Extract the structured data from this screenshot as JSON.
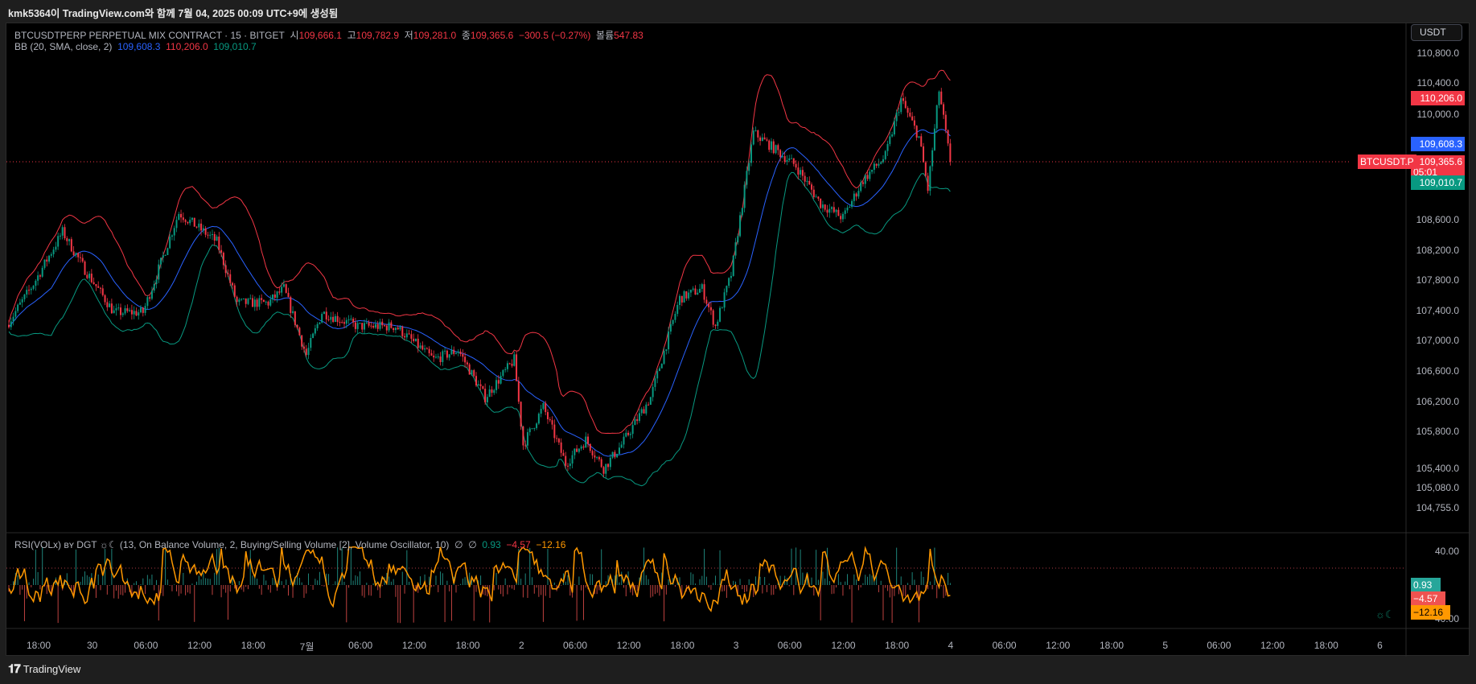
{
  "header": {
    "caption": "kmk5364이 TradingView.com와 함께 7월 04, 2025 00:09 UTC+9에 생성됨"
  },
  "legend": {
    "symbol": "BTCUSDTPERP PERPETUAL MIX CONTRACT · 15 · BITGET",
    "o_label": "시",
    "o": "109,666.1",
    "h_label": "고",
    "h": "109,782.9",
    "l_label": "저",
    "l": "109,281.0",
    "c_label": "종",
    "c": "109,365.6",
    "change": "−300.5 (−0.27%)",
    "vol_label": "볼륨",
    "vol": "547.83",
    "bb_name": "BB (20, SMA, close, 2)",
    "bb_basis": "109,608.3",
    "bb_upper": "110,206.0",
    "bb_lower": "109,010.7"
  },
  "price_axis": {
    "currency": "USDT",
    "ticks": [
      "110,800.0",
      "110,400.0",
      "110,000.0",
      "108,600.0",
      "108,200.0",
      "107,800.0",
      "107,400.0",
      "107,000.0",
      "106,600.0",
      "106,200.0",
      "105,800.0",
      "105,400.0",
      "105,080.0",
      "104,755.0"
    ],
    "tick_values": [
      110800,
      110400,
      110000,
      108600,
      108200,
      107800,
      107400,
      107000,
      106600,
      106200,
      105800,
      105400,
      105080,
      104755
    ],
    "symbol_tag": "BTCUSDT.P",
    "last_price": "109,365.6",
    "countdown": "05:01",
    "upper_tag": "110,206.0",
    "basis_tag": "109,608.3",
    "lower_tag": "109,010.7"
  },
  "oscillator": {
    "title": "RSI(VOLx) ʙʏ DGT ☼☾ (13, On Balance Volume, 2, Buying/Selling Volume [2], Volume Oscillator, 10)",
    "null1": "∅",
    "null2": "∅",
    "v1": "0.93",
    "v2": "−4.57",
    "v3": "−12.16",
    "tick_top": "40.00",
    "tick_bottom": "−40.00",
    "icon": "☼☾"
  },
  "time_axis": [
    "18:00",
    "30",
    "06:00",
    "12:00",
    "18:00",
    "7월",
    "06:00",
    "12:00",
    "18:00",
    "2",
    "06:00",
    "12:00",
    "18:00",
    "3",
    "06:00",
    "12:00",
    "18:00",
    "4",
    "06:00",
    "12:00",
    "18:00",
    "5",
    "06:00",
    "12:00",
    "18:00",
    "6"
  ],
  "footer": {
    "brand": "TradingView"
  },
  "colors": {
    "up": "#089981",
    "down": "#f23645",
    "basis": "#2962ff",
    "osc": "#ff9800"
  },
  "price_path": [
    [
      0,
      107250
    ],
    [
      11,
      107750
    ],
    [
      24,
      108440
    ],
    [
      34,
      107940
    ],
    [
      47,
      107375
    ],
    [
      60,
      107375
    ],
    [
      76,
      108690
    ],
    [
      93,
      108310
    ],
    [
      102,
      107500
    ],
    [
      116,
      107500
    ],
    [
      123,
      107690
    ],
    [
      133,
      106810
    ],
    [
      140,
      107375
    ],
    [
      156,
      107190
    ],
    [
      173,
      107190
    ],
    [
      190,
      106750
    ],
    [
      201,
      106875
    ],
    [
      213,
      106250
    ],
    [
      226,
      106750
    ],
    [
      230,
      105625
    ],
    [
      239,
      106125
    ],
    [
      249,
      105375
    ],
    [
      258,
      105690
    ],
    [
      266,
      105310
    ],
    [
      274,
      105625
    ],
    [
      287,
      106250
    ],
    [
      300,
      107560
    ],
    [
      310,
      107690
    ],
    [
      316,
      107190
    ],
    [
      323,
      107875
    ],
    [
      333,
      109750
    ],
    [
      344,
      109500
    ],
    [
      352,
      109310
    ],
    [
      363,
      108810
    ],
    [
      373,
      108625
    ],
    [
      382,
      109125
    ],
    [
      392,
      109440
    ],
    [
      399,
      110190
    ],
    [
      407,
      109690
    ],
    [
      411,
      109000
    ],
    [
      416,
      110310
    ],
    [
      421,
      109365.6
    ]
  ]
}
